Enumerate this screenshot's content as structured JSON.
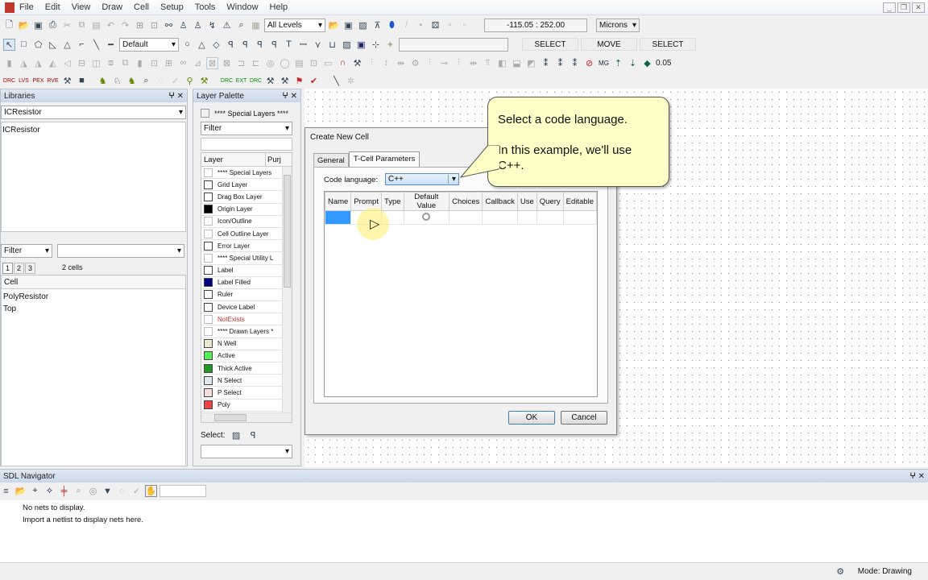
{
  "menu": [
    "File",
    "Edit",
    "View",
    "Draw",
    "Cell",
    "Setup",
    "Tools",
    "Window",
    "Help"
  ],
  "toolbar": {
    "levels": "All Levels",
    "style": "Default",
    "coords": "-115.05 : 252.00",
    "units": "Microns",
    "mode1": "SELECT",
    "mode2": "MOVE",
    "mode3": "SELECT",
    "grid_value": "0.05"
  },
  "libraries": {
    "title": "Libraries",
    "selected": "ICResistor",
    "items": [
      "ICResistor"
    ],
    "filter": "Filter",
    "tabs": [
      "1",
      "2",
      "3"
    ],
    "cell_count": "2 cells",
    "cell_header": "Cell",
    "cells": [
      "PolyResistor",
      "Top"
    ]
  },
  "layer_palette": {
    "title": "Layer Palette",
    "special": "**** Special Layers ****",
    "filter": "Filter",
    "col_layer": "Layer",
    "col_purpose": "Purj",
    "select_label": "Select:",
    "layers": [
      {
        "name": "**** Special Layers",
        "color": "#ffffff"
      },
      {
        "name": "Grid Layer",
        "color": "#ffffff"
      },
      {
        "name": "Drag Box Layer",
        "color": "#ffffff"
      },
      {
        "name": "Origin Layer",
        "color": "#000000"
      },
      {
        "name": "Icon/Outline",
        "color": "#ffffff"
      },
      {
        "name": "Cell Outline Layer",
        "color": "#ffffff"
      },
      {
        "name": "Error Layer",
        "color": "#ffffff"
      },
      {
        "name": "**** Special Utility L",
        "color": "#ffffff"
      },
      {
        "name": "Label",
        "color": "#ffffff"
      },
      {
        "name": "Label Filled",
        "color": "#000080"
      },
      {
        "name": "Ruler",
        "color": "#ffffff"
      },
      {
        "name": "Device Label",
        "color": "#ffffff"
      },
      {
        "name": "NotExists",
        "color": "#ffffff"
      },
      {
        "name": "**** Drawn Layers *",
        "color": "#ffffff"
      },
      {
        "name": "N Well",
        "color": "#e8e8d0"
      },
      {
        "name": "Active",
        "color": "#55ee55"
      },
      {
        "name": "Thick Active",
        "color": "#229922"
      },
      {
        "name": "N Select",
        "color": "#dde8f0"
      },
      {
        "name": "P Select",
        "color": "#f4dcdc"
      },
      {
        "name": "Poly",
        "color": "#ee4444"
      }
    ]
  },
  "dialog": {
    "title": "Create New Cell",
    "tabs": [
      "General",
      "T-Cell Parameters"
    ],
    "code_language_label": "Code language:",
    "code_language": "C++",
    "columns": [
      "Name",
      "Prompt",
      "Type",
      "Default Value",
      "Choices",
      "Callback",
      "Use",
      "Query",
      "Editable"
    ],
    "ok": "OK",
    "cancel": "Cancel"
  },
  "callout": {
    "line1": "Select a code language.",
    "line2": "In this example, we'll use C++."
  },
  "navigator": {
    "title": "SDL Navigator",
    "msg1": "No nets to display.",
    "msg2": "Import a netlist to display nets here."
  },
  "status": {
    "mode": "Mode: Drawing"
  }
}
